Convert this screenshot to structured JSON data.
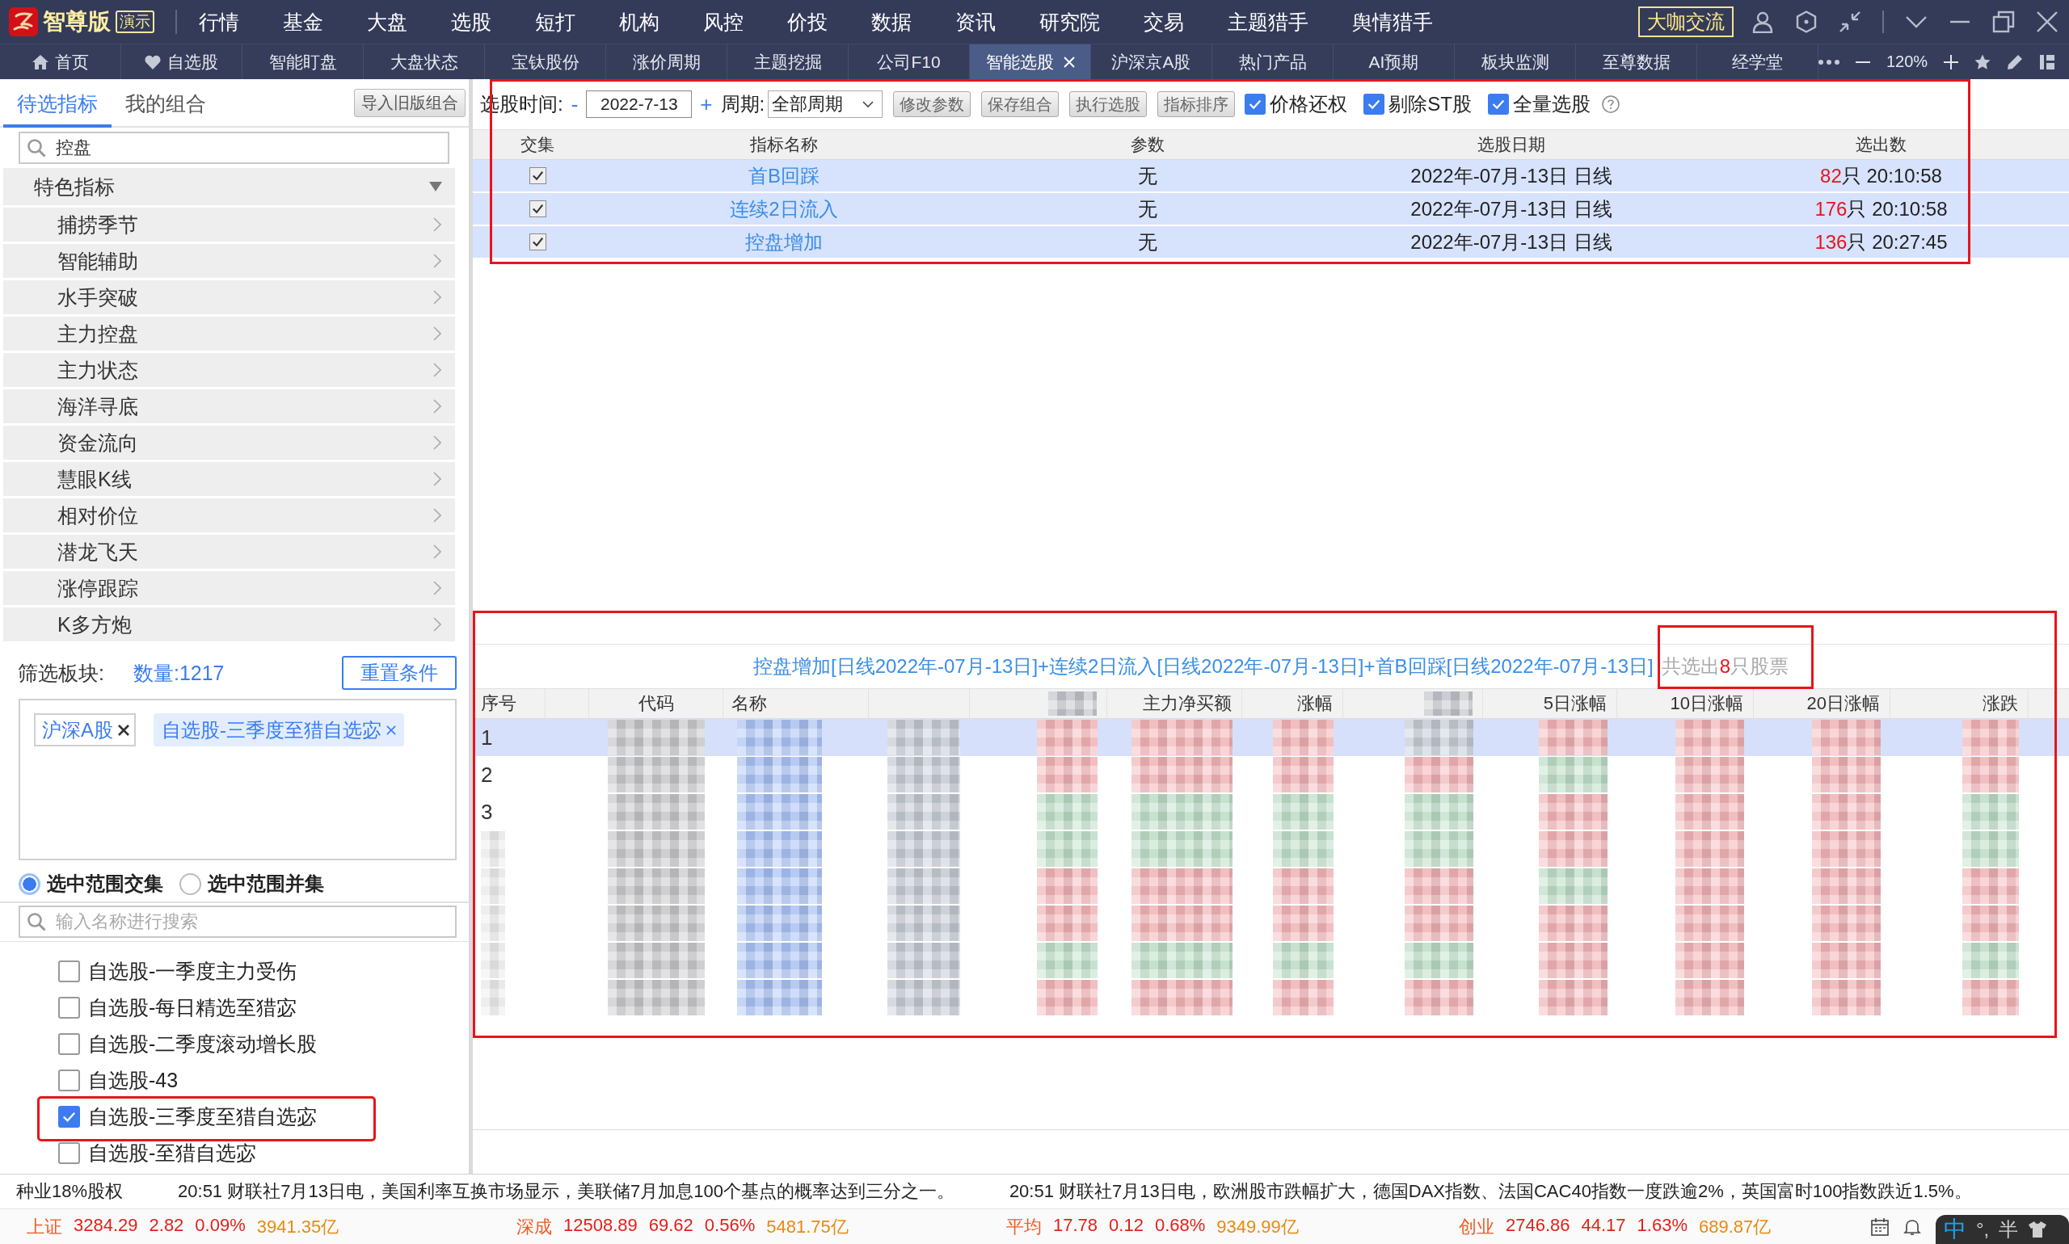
{
  "title_bar": {
    "logo": "智尊版",
    "badge": "演示",
    "menu": [
      "行情",
      "基金",
      "大盘",
      "选股",
      "短打",
      "机构",
      "风控",
      "价投",
      "数据",
      "资讯",
      "研究院",
      "交易",
      "主题猎手",
      "舆情猎手"
    ],
    "community_button": "大咖交流"
  },
  "tabs": [
    {
      "label": "首页",
      "kind": "home",
      "selected": false
    },
    {
      "label": "自选股",
      "kind": "favorite",
      "selected": false
    },
    {
      "label": "智能盯盘",
      "kind": "plain",
      "selected": false
    },
    {
      "label": "大盘状态",
      "kind": "plain",
      "selected": false
    },
    {
      "label": "宝钛股份",
      "kind": "plain",
      "selected": false
    },
    {
      "label": "涨价周期",
      "kind": "plain",
      "selected": false
    },
    {
      "label": "主题挖掘",
      "kind": "plain",
      "selected": false
    },
    {
      "label": "公司F10",
      "kind": "plain",
      "selected": false
    },
    {
      "label": "智能选股",
      "kind": "plain",
      "selected": true
    },
    {
      "label": "沪深京A股",
      "kind": "plain",
      "selected": false
    },
    {
      "label": "热门产品",
      "kind": "plain",
      "selected": false
    },
    {
      "label": "AI预期",
      "kind": "plain",
      "selected": false
    },
    {
      "label": "板块监测",
      "kind": "plain",
      "selected": false
    },
    {
      "label": "至尊数据",
      "kind": "plain",
      "selected": false
    },
    {
      "label": "经学堂",
      "kind": "plain",
      "selected": false
    }
  ],
  "tab_tools": {
    "zoom": "120%"
  },
  "left_panel": {
    "tabs": [
      {
        "label": "待选指标",
        "selected": true
      },
      {
        "label": "我的组合",
        "selected": false
      }
    ],
    "import_button": "导入旧版组合",
    "search": {
      "value": "控盘"
    },
    "category": {
      "label": "特色指标",
      "expanded": true,
      "children": [
        {
          "label": "捕捞季节"
        },
        {
          "label": "智能辅助"
        },
        {
          "label": "水手突破"
        },
        {
          "label": "主力控盘"
        },
        {
          "label": "主力状态"
        },
        {
          "label": "海洋寻底"
        },
        {
          "label": "资金流向"
        },
        {
          "label": "慧眼K线"
        },
        {
          "label": "相对价位"
        },
        {
          "label": "潜龙飞天"
        },
        {
          "label": "涨停跟踪"
        },
        {
          "label": "K多方炮"
        }
      ]
    }
  },
  "filter": {
    "label": "筛选板块:",
    "count": "数量:1217",
    "reset_button": "重置条件",
    "tags": [
      {
        "label": "沪深A股",
        "kind": "outlined"
      },
      {
        "label": "自选股-三季度至猎自选宓",
        "kind": "filled"
      }
    ],
    "modes": [
      {
        "label": "选中范围交集",
        "selected": true
      },
      {
        "label": "选中范围并集",
        "selected": false
      }
    ],
    "search": {
      "placeholder": "输入名称进行搜索"
    },
    "items": [
      {
        "label": "自选股-一季度主力受伤",
        "checked": false,
        "highlighted": false
      },
      {
        "label": "自选股-每日精选至猎宓",
        "checked": false,
        "highlighted": false
      },
      {
        "label": "自选股-二季度滚动增长股",
        "checked": false,
        "highlighted": false
      },
      {
        "label": "自选股-43",
        "checked": false,
        "highlighted": false
      },
      {
        "label": "自选股-三季度至猎自选宓",
        "checked": true,
        "highlighted": true
      },
      {
        "label": "自选股-至猎自选宓",
        "checked": false,
        "highlighted": false
      }
    ]
  },
  "screener": {
    "highlighted": true,
    "toolbar": {
      "time_label": "选股时间:",
      "step_down": "-",
      "date": "2022-7-13",
      "step_up": "+",
      "period_label": "周期:",
      "period": "全部周期",
      "buttons": [
        "修改参数",
        "保存组合",
        "执行选股",
        "指标排序"
      ],
      "options": [
        {
          "label": "价格还权",
          "checked": true
        },
        {
          "label": "剔除ST股",
          "checked": true
        },
        {
          "label": "全量选股",
          "checked": true
        }
      ]
    },
    "table": {
      "columns": [
        "交集",
        "指标名称",
        "参数",
        "选股日期",
        "选出数"
      ],
      "rows": [
        {
          "selected": true,
          "checked": true,
          "name": "首B回踩",
          "param": "无",
          "date": "2022年-07月-13日 日线",
          "count": "82",
          "unit": "只",
          "time": "20:10:58"
        },
        {
          "selected": true,
          "checked": true,
          "name": "连续2日流入",
          "param": "无",
          "date": "2022年-07月-13日 日线",
          "count": "176",
          "unit": "只",
          "time": "20:10:58"
        },
        {
          "selected": true,
          "checked": true,
          "name": "控盘增加",
          "param": "无",
          "date": "2022年-07月-13日 日线",
          "count": "136",
          "unit": "只",
          "time": "20:27:45"
        }
      ]
    }
  },
  "results": {
    "highlighted": true,
    "title": "控盘增加[日线2022年-07月-13日]+连续2日流入[日线2022年-07月-13日]+首B回踩[日线2022年-07月-13日]",
    "summary": {
      "highlighted": true,
      "prefix": "共选出",
      "count": "8",
      "suffix": "只股票"
    },
    "columns": [
      {
        "kind": "text",
        "label": "序号"
      },
      {
        "kind": "blank"
      },
      {
        "kind": "text",
        "label": "代码"
      },
      {
        "kind": "text",
        "label": "名称"
      },
      {
        "kind": "blank"
      },
      {
        "kind": "blurred"
      },
      {
        "kind": "text",
        "label": "主力净买额"
      },
      {
        "kind": "text",
        "label": "涨幅"
      },
      {
        "kind": "blurred"
      },
      {
        "kind": "text",
        "label": "5日涨幅"
      },
      {
        "kind": "text",
        "label": "10日涨幅"
      },
      {
        "kind": "text",
        "label": "20日涨幅"
      },
      {
        "kind": "text",
        "label": "涨跌"
      }
    ],
    "rows": [
      {
        "number": "1",
        "selected": true,
        "cells": [
          {
            "kind": "code"
          },
          {
            "kind": "name"
          },
          {
            "kind": "misc"
          },
          {
            "kind": "rise"
          },
          {
            "kind": "rise"
          },
          {
            "kind": "rise"
          },
          {
            "kind": "misc"
          },
          {
            "kind": "rise"
          },
          {
            "kind": "rise"
          },
          {
            "kind": "rise"
          },
          {
            "kind": "rise"
          }
        ]
      },
      {
        "number": "2",
        "selected": false,
        "cells": [
          {
            "kind": "code"
          },
          {
            "kind": "name"
          },
          {
            "kind": "misc"
          },
          {
            "kind": "rise"
          },
          {
            "kind": "rise"
          },
          {
            "kind": "rise"
          },
          {
            "kind": "rise"
          },
          {
            "kind": "fall"
          },
          {
            "kind": "rise"
          },
          {
            "kind": "rise"
          },
          {
            "kind": "rise"
          }
        ]
      },
      {
        "number": "3",
        "selected": false,
        "cells": [
          {
            "kind": "code"
          },
          {
            "kind": "name"
          },
          {
            "kind": "misc"
          },
          {
            "kind": "fall"
          },
          {
            "kind": "fall"
          },
          {
            "kind": "fall"
          },
          {
            "kind": "fall"
          },
          {
            "kind": "rise"
          },
          {
            "kind": "rise"
          },
          {
            "kind": "rise"
          },
          {
            "kind": "fall"
          }
        ]
      },
      {
        "selected": false,
        "cells": [
          {
            "kind": "code"
          },
          {
            "kind": "name"
          },
          {
            "kind": "misc"
          },
          {
            "kind": "fall"
          },
          {
            "kind": "fall"
          },
          {
            "kind": "fall"
          },
          {
            "kind": "fall"
          },
          {
            "kind": "rise"
          },
          {
            "kind": "rise"
          },
          {
            "kind": "rise"
          },
          {
            "kind": "fall"
          }
        ]
      },
      {
        "selected": false,
        "cells": [
          {
            "kind": "code"
          },
          {
            "kind": "name"
          },
          {
            "kind": "misc"
          },
          {
            "kind": "rise"
          },
          {
            "kind": "rise"
          },
          {
            "kind": "rise"
          },
          {
            "kind": "rise"
          },
          {
            "kind": "fall"
          },
          {
            "kind": "rise"
          },
          {
            "kind": "rise"
          },
          {
            "kind": "rise"
          }
        ]
      },
      {
        "selected": false,
        "cells": [
          {
            "kind": "code"
          },
          {
            "kind": "name"
          },
          {
            "kind": "misc"
          },
          {
            "kind": "rise"
          },
          {
            "kind": "rise"
          },
          {
            "kind": "rise"
          },
          {
            "kind": "rise"
          },
          {
            "kind": "rise"
          },
          {
            "kind": "rise"
          },
          {
            "kind": "rise"
          },
          {
            "kind": "rise"
          }
        ]
      },
      {
        "selected": false,
        "cells": [
          {
            "kind": "code"
          },
          {
            "kind": "name"
          },
          {
            "kind": "misc"
          },
          {
            "kind": "fall"
          },
          {
            "kind": "fall"
          },
          {
            "kind": "fall"
          },
          {
            "kind": "fall"
          },
          {
            "kind": "rise"
          },
          {
            "kind": "rise"
          },
          {
            "kind": "rise"
          },
          {
            "kind": "fall"
          }
        ]
      },
      {
        "selected": false,
        "cells": [
          {
            "kind": "code"
          },
          {
            "kind": "name"
          },
          {
            "kind": "misc"
          },
          {
            "kind": "rise"
          },
          {
            "kind": "rise"
          },
          {
            "kind": "rise"
          },
          {
            "kind": "rise"
          },
          {
            "kind": "rise"
          },
          {
            "kind": "rise"
          },
          {
            "kind": "rise"
          },
          {
            "kind": "rise"
          }
        ]
      }
    ]
  },
  "news_ticker": [
    "种业18%股权",
    "20:51 财联社7月13日电，美国利率互换市场显示，美联储7月加息100个基点的概率达到三分之一。",
    "20:51 财联社7月13日电，欧洲股市跌幅扩大，德国DAX指数、法国CAC40指数一度跌逾2%，英国富时100指数跌近1.5%。"
  ],
  "indices": [
    {
      "name": "上证",
      "price": "3284.29",
      "change": "2.82",
      "percent": "0.09%",
      "turnover": "3941.35亿",
      "rising": true
    },
    {
      "name": "深成",
      "price": "12508.89",
      "change": "69.62",
      "percent": "0.56%",
      "turnover": "5481.75亿",
      "rising": true
    },
    {
      "name": "平均",
      "price": "17.78",
      "change": "0.12",
      "percent": "0.68%",
      "turnover": "9349.99亿",
      "rising": true
    },
    {
      "name": "创业",
      "price": "2746.86",
      "change": "44.17",
      "percent": "1.63%",
      "turnover": "689.87亿",
      "rising": true
    }
  ],
  "ime": {
    "mode": "中",
    "punctuation": "°,",
    "width": "半"
  }
}
